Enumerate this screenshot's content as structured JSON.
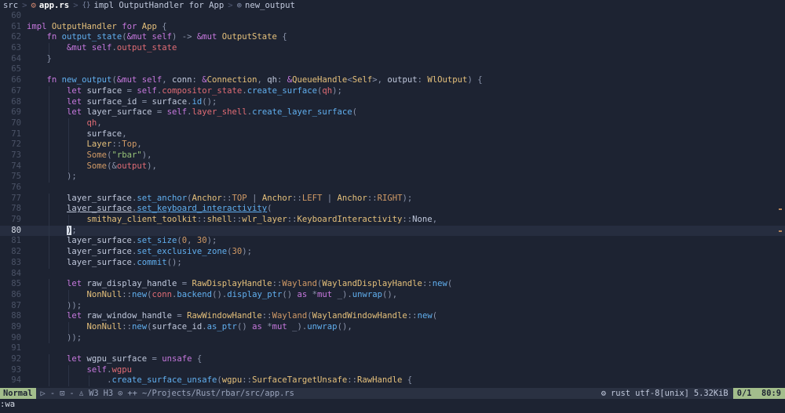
{
  "breadcrumb": {
    "items": [
      "src",
      "app.rs",
      "impl OutputHandler for App",
      "new_output"
    ]
  },
  "editor": {
    "current_line": 80,
    "lines": [
      {
        "n": 60,
        "tokens": []
      },
      {
        "n": 61,
        "tokens": [
          [
            "kw",
            "impl "
          ],
          [
            "ty",
            "OutputHandler "
          ],
          [
            "kw",
            "for "
          ],
          [
            "ty",
            "App "
          ],
          [
            "pn",
            "{"
          ]
        ]
      },
      {
        "n": 62,
        "tokens": [
          [
            "pl",
            "    "
          ],
          [
            "kw",
            "fn "
          ],
          [
            "fn",
            "output_state"
          ],
          [
            "pn",
            "("
          ],
          [
            "kw",
            "&mut self"
          ],
          [
            "pn",
            ") -> "
          ],
          [
            "kw",
            "&mut "
          ],
          [
            "ty",
            "OutputState "
          ],
          [
            "pn",
            "{"
          ]
        ]
      },
      {
        "n": 63,
        "tokens": [
          [
            "pl",
            "        "
          ],
          [
            "kw",
            "&mut self"
          ],
          [
            "pn",
            "."
          ],
          [
            "vr",
            "output_state"
          ]
        ]
      },
      {
        "n": 64,
        "tokens": [
          [
            "pl",
            "    "
          ],
          [
            "pn",
            "}"
          ]
        ]
      },
      {
        "n": 65,
        "tokens": []
      },
      {
        "n": 66,
        "tokens": [
          [
            "pl",
            "    "
          ],
          [
            "kw",
            "fn "
          ],
          [
            "fn",
            "new_output"
          ],
          [
            "pn",
            "("
          ],
          [
            "kw",
            "&mut self"
          ],
          [
            "pn",
            ", "
          ],
          [
            "pl",
            "conn"
          ],
          [
            "pn",
            ": "
          ],
          [
            "kw",
            "&"
          ],
          [
            "ty",
            "Connection"
          ],
          [
            "pn",
            ", "
          ],
          [
            "pl",
            "qh"
          ],
          [
            "pn",
            ": "
          ],
          [
            "kw",
            "&"
          ],
          [
            "ty",
            "QueueHandle"
          ],
          [
            "pn",
            "<"
          ],
          [
            "ty",
            "Self"
          ],
          [
            "pn",
            ">, "
          ],
          [
            "pl",
            "output"
          ],
          [
            "pn",
            ": "
          ],
          [
            "ty",
            "WlOutput"
          ],
          [
            "pn",
            ") {"
          ]
        ]
      },
      {
        "n": 67,
        "tokens": [
          [
            "pl",
            "        "
          ],
          [
            "kw",
            "let "
          ],
          [
            "pl",
            "surface "
          ],
          [
            "pn",
            "= "
          ],
          [
            "kw",
            "self"
          ],
          [
            "pn",
            "."
          ],
          [
            "vr",
            "compositor_state"
          ],
          [
            "pn",
            "."
          ],
          [
            "fn",
            "create_surface"
          ],
          [
            "pn",
            "("
          ],
          [
            "vr",
            "qh"
          ],
          [
            "pn",
            ");"
          ]
        ]
      },
      {
        "n": 68,
        "tokens": [
          [
            "pl",
            "        "
          ],
          [
            "kw",
            "let "
          ],
          [
            "pl",
            "surface_id "
          ],
          [
            "pn",
            "= "
          ],
          [
            "pl",
            "surface"
          ],
          [
            "pn",
            "."
          ],
          [
            "fn",
            "id"
          ],
          [
            "pn",
            "();"
          ]
        ]
      },
      {
        "n": 69,
        "tokens": [
          [
            "pl",
            "        "
          ],
          [
            "kw",
            "let "
          ],
          [
            "pl",
            "layer_surface "
          ],
          [
            "pn",
            "= "
          ],
          [
            "kw",
            "self"
          ],
          [
            "pn",
            "."
          ],
          [
            "vr",
            "layer_shell"
          ],
          [
            "pn",
            "."
          ],
          [
            "fn",
            "create_layer_surface"
          ],
          [
            "pn",
            "("
          ]
        ]
      },
      {
        "n": 70,
        "tokens": [
          [
            "pl",
            "            "
          ],
          [
            "vr",
            "qh"
          ],
          [
            "pn",
            ","
          ]
        ]
      },
      {
        "n": 71,
        "tokens": [
          [
            "pl",
            "            surface"
          ],
          [
            "pn",
            ","
          ]
        ]
      },
      {
        "n": 72,
        "tokens": [
          [
            "pl",
            "            "
          ],
          [
            "ty",
            "Layer"
          ],
          [
            "pn",
            "::"
          ],
          [
            "nm",
            "Top"
          ],
          [
            "pn",
            ","
          ]
        ]
      },
      {
        "n": 73,
        "tokens": [
          [
            "pl",
            "            "
          ],
          [
            "nm",
            "Some"
          ],
          [
            "pn",
            "("
          ],
          [
            "st",
            "\"rbar\""
          ],
          [
            "pn",
            "),"
          ]
        ]
      },
      {
        "n": 74,
        "tokens": [
          [
            "pl",
            "            "
          ],
          [
            "nm",
            "Some"
          ],
          [
            "pn",
            "(&"
          ],
          [
            "vr",
            "output"
          ],
          [
            "pn",
            "),"
          ]
        ]
      },
      {
        "n": 75,
        "tokens": [
          [
            "pl",
            "        "
          ],
          [
            "pn",
            ");"
          ]
        ]
      },
      {
        "n": 76,
        "tokens": []
      },
      {
        "n": 77,
        "tokens": [
          [
            "pl",
            "        layer_surface"
          ],
          [
            "pn",
            "."
          ],
          [
            "fn",
            "set_anchor"
          ],
          [
            "pn",
            "("
          ],
          [
            "ty",
            "Anchor"
          ],
          [
            "pn",
            "::"
          ],
          [
            "nm",
            "TOP "
          ],
          [
            "pn",
            "| "
          ],
          [
            "ty",
            "Anchor"
          ],
          [
            "pn",
            "::"
          ],
          [
            "nm",
            "LEFT "
          ],
          [
            "pn",
            "| "
          ],
          [
            "ty",
            "Anchor"
          ],
          [
            "pn",
            "::"
          ],
          [
            "nm",
            "RIGHT"
          ],
          [
            "pn",
            ");"
          ]
        ]
      },
      {
        "n": 78,
        "tokens": [
          [
            "pl",
            "        "
          ],
          [
            "pl ul",
            "layer_surface"
          ],
          [
            "pn ul",
            "."
          ],
          [
            "fn ul",
            "set_keyboard_interactivity"
          ],
          [
            "pn",
            "("
          ]
        ]
      },
      {
        "n": 79,
        "tokens": [
          [
            "pl",
            "            "
          ],
          [
            "ty",
            "smithay_client_toolkit"
          ],
          [
            "pn",
            "::"
          ],
          [
            "ty",
            "shell"
          ],
          [
            "pn",
            "::"
          ],
          [
            "ty",
            "wlr_layer"
          ],
          [
            "pn",
            "::"
          ],
          [
            "ty",
            "KeyboardInteractivity"
          ],
          [
            "pn",
            "::"
          ],
          [
            "pl",
            "None"
          ],
          [
            "pn",
            ","
          ]
        ]
      },
      {
        "n": 80,
        "tokens": [
          [
            "pl",
            "        "
          ],
          [
            "pn cursor",
            ")"
          ],
          [
            "pn",
            ";"
          ]
        ]
      },
      {
        "n": 81,
        "tokens": [
          [
            "pl",
            "        layer_surface"
          ],
          [
            "pn",
            "."
          ],
          [
            "fn",
            "set_size"
          ],
          [
            "pn",
            "("
          ],
          [
            "nm",
            "0"
          ],
          [
            "pn",
            ", "
          ],
          [
            "nm",
            "30"
          ],
          [
            "pn",
            ");"
          ]
        ]
      },
      {
        "n": 82,
        "tokens": [
          [
            "pl",
            "        layer_surface"
          ],
          [
            "pn",
            "."
          ],
          [
            "fn",
            "set_exclusive_zone"
          ],
          [
            "pn",
            "("
          ],
          [
            "nm",
            "30"
          ],
          [
            "pn",
            ");"
          ]
        ]
      },
      {
        "n": 83,
        "tokens": [
          [
            "pl",
            "        layer_surface"
          ],
          [
            "pn",
            "."
          ],
          [
            "fn",
            "commit"
          ],
          [
            "pn",
            "();"
          ]
        ]
      },
      {
        "n": 84,
        "tokens": []
      },
      {
        "n": 85,
        "tokens": [
          [
            "pl",
            "        "
          ],
          [
            "kw",
            "let "
          ],
          [
            "pl",
            "raw_display_handle "
          ],
          [
            "pn",
            "= "
          ],
          [
            "ty",
            "RawDisplayHandle"
          ],
          [
            "pn",
            "::"
          ],
          [
            "nm",
            "Wayland"
          ],
          [
            "pn",
            "("
          ],
          [
            "ty",
            "WaylandDisplayHandle"
          ],
          [
            "pn",
            "::"
          ],
          [
            "fn",
            "new"
          ],
          [
            "pn",
            "("
          ]
        ]
      },
      {
        "n": 86,
        "tokens": [
          [
            "pl",
            "            "
          ],
          [
            "ty",
            "NonNull"
          ],
          [
            "pn",
            "::"
          ],
          [
            "fn",
            "new"
          ],
          [
            "pn",
            "("
          ],
          [
            "vr",
            "conn"
          ],
          [
            "pn",
            "."
          ],
          [
            "fn",
            "backend"
          ],
          [
            "pn",
            "()."
          ],
          [
            "fn",
            "display_ptr"
          ],
          [
            "pn",
            "() "
          ],
          [
            "kw",
            "as "
          ],
          [
            "pn",
            "*"
          ],
          [
            "kw",
            "mut "
          ],
          [
            "pn",
            "_)."
          ],
          [
            "fn",
            "unwrap"
          ],
          [
            "pn",
            "(),"
          ]
        ]
      },
      {
        "n": 87,
        "tokens": [
          [
            "pl",
            "        "
          ],
          [
            "pn",
            "));"
          ]
        ]
      },
      {
        "n": 88,
        "tokens": [
          [
            "pl",
            "        "
          ],
          [
            "kw",
            "let "
          ],
          [
            "pl",
            "raw_window_handle "
          ],
          [
            "pn",
            "= "
          ],
          [
            "ty",
            "RawWindowHandle"
          ],
          [
            "pn",
            "::"
          ],
          [
            "nm",
            "Wayland"
          ],
          [
            "pn",
            "("
          ],
          [
            "ty",
            "WaylandWindowHandle"
          ],
          [
            "pn",
            "::"
          ],
          [
            "fn",
            "new"
          ],
          [
            "pn",
            "("
          ]
        ]
      },
      {
        "n": 89,
        "tokens": [
          [
            "pl",
            "            "
          ],
          [
            "ty",
            "NonNull"
          ],
          [
            "pn",
            "::"
          ],
          [
            "fn",
            "new"
          ],
          [
            "pn",
            "("
          ],
          [
            "pl",
            "surface_id"
          ],
          [
            "pn",
            "."
          ],
          [
            "fn",
            "as_ptr"
          ],
          [
            "pn",
            "() "
          ],
          [
            "kw",
            "as "
          ],
          [
            "pn",
            "*"
          ],
          [
            "kw",
            "mut "
          ],
          [
            "pn",
            "_)."
          ],
          [
            "fn",
            "unwrap"
          ],
          [
            "pn",
            "(),"
          ]
        ]
      },
      {
        "n": 90,
        "tokens": [
          [
            "pl",
            "        "
          ],
          [
            "pn",
            "));"
          ]
        ]
      },
      {
        "n": 91,
        "tokens": []
      },
      {
        "n": 92,
        "tokens": [
          [
            "pl",
            "        "
          ],
          [
            "kw",
            "let "
          ],
          [
            "pl",
            "wgpu_surface "
          ],
          [
            "pn",
            "= "
          ],
          [
            "kw",
            "unsafe "
          ],
          [
            "pn",
            "{"
          ]
        ]
      },
      {
        "n": 93,
        "tokens": [
          [
            "pl",
            "            "
          ],
          [
            "kw",
            "self"
          ],
          [
            "pn",
            "."
          ],
          [
            "vr",
            "wgpu"
          ]
        ]
      },
      {
        "n": 94,
        "tokens": [
          [
            "pl",
            "                "
          ],
          [
            "pn",
            "."
          ],
          [
            "fn",
            "create_surface_unsafe"
          ],
          [
            "pn",
            "("
          ],
          [
            "ty",
            "wgpu"
          ],
          [
            "pn",
            "::"
          ],
          [
            "ty",
            "SurfaceTargetUnsafe"
          ],
          [
            "pn",
            "::"
          ],
          [
            "ty",
            "RawHandle "
          ],
          [
            "pn",
            "{"
          ]
        ]
      }
    ]
  },
  "statusline": {
    "mode": "Normal",
    "left_items": [
      "▷",
      "-",
      "⊡",
      "-",
      "♙ W3",
      "H3",
      "⊙",
      "++",
      "~/Projects/Rust/rbar/src/app.rs"
    ],
    "filetype_icon": "⚙",
    "filetype": "rust",
    "encoding": "utf-8[unix]",
    "size": "5.32KiB",
    "position": "0/1  80:9"
  },
  "cmdline": ":wa",
  "colors": {
    "background": "#1d2332",
    "keyword": "#c678dd",
    "type": "#e5c07b",
    "function": "#61afef",
    "variable": "#e06c75",
    "string": "#98c379",
    "number": "#d19a66",
    "mode_bg": "#a3be8c"
  },
  "diagnostics_lines": [
    78,
    80
  ]
}
